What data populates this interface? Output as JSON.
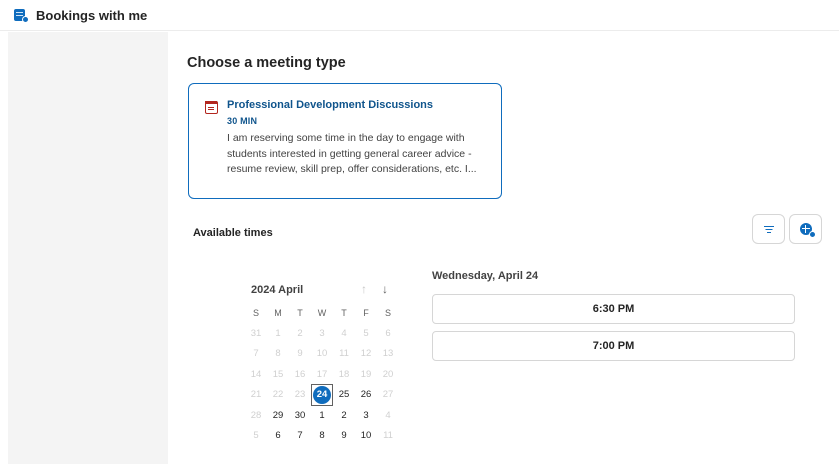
{
  "app": {
    "title": "Bookings with me"
  },
  "main": {
    "section_title": "Choose a meeting type",
    "meeting_card": {
      "title": "Professional Development Discussions",
      "duration": "30 MIN",
      "description": "I am reserving some time in the day to engage with students interested in getting general career advice - resume review, skill prep, offer considerations, etc. I..."
    },
    "available_label": "Available times",
    "toolbar": {
      "filter_icon": "filter-icon",
      "timezone_icon": "globe-clock-icon"
    }
  },
  "calendar": {
    "month_label": "2024 April",
    "weekdays": [
      "S",
      "M",
      "T",
      "W",
      "T",
      "F",
      "S"
    ],
    "selected_day": "24",
    "weeks": [
      [
        {
          "d": "31",
          "s": "off"
        },
        {
          "d": "1",
          "s": "off"
        },
        {
          "d": "2",
          "s": "off"
        },
        {
          "d": "3",
          "s": "off"
        },
        {
          "d": "4",
          "s": "off"
        },
        {
          "d": "5",
          "s": "off"
        },
        {
          "d": "6",
          "s": "off"
        }
      ],
      [
        {
          "d": "7",
          "s": "off"
        },
        {
          "d": "8",
          "s": "off"
        },
        {
          "d": "9",
          "s": "off"
        },
        {
          "d": "10",
          "s": "off"
        },
        {
          "d": "11",
          "s": "off"
        },
        {
          "d": "12",
          "s": "off"
        },
        {
          "d": "13",
          "s": "off"
        }
      ],
      [
        {
          "d": "14",
          "s": "off"
        },
        {
          "d": "15",
          "s": "off"
        },
        {
          "d": "16",
          "s": "off"
        },
        {
          "d": "17",
          "s": "off"
        },
        {
          "d": "18",
          "s": "off"
        },
        {
          "d": "19",
          "s": "off"
        },
        {
          "d": "20",
          "s": "off"
        }
      ],
      [
        {
          "d": "21",
          "s": "off"
        },
        {
          "d": "22",
          "s": "off"
        },
        {
          "d": "23",
          "s": "off"
        },
        {
          "d": "24",
          "s": "sel"
        },
        {
          "d": "25",
          "s": "avail"
        },
        {
          "d": "26",
          "s": "avail"
        },
        {
          "d": "27",
          "s": "off"
        }
      ],
      [
        {
          "d": "28",
          "s": "off"
        },
        {
          "d": "29",
          "s": "avail"
        },
        {
          "d": "30",
          "s": "avail"
        },
        {
          "d": "1",
          "s": "avail"
        },
        {
          "d": "2",
          "s": "avail"
        },
        {
          "d": "3",
          "s": "avail"
        },
        {
          "d": "4",
          "s": "off"
        }
      ],
      [
        {
          "d": "5",
          "s": "off"
        },
        {
          "d": "6",
          "s": "avail"
        },
        {
          "d": "7",
          "s": "avail"
        },
        {
          "d": "8",
          "s": "avail"
        },
        {
          "d": "9",
          "s": "avail"
        },
        {
          "d": "10",
          "s": "avail"
        },
        {
          "d": "11",
          "s": "off"
        }
      ]
    ]
  },
  "times": {
    "date_heading": "Wednesday, April 24",
    "slots": [
      "6:30 PM",
      "7:00 PM"
    ]
  },
  "colors": {
    "accent": "#0f6cbd",
    "card_title": "#0f548c"
  }
}
